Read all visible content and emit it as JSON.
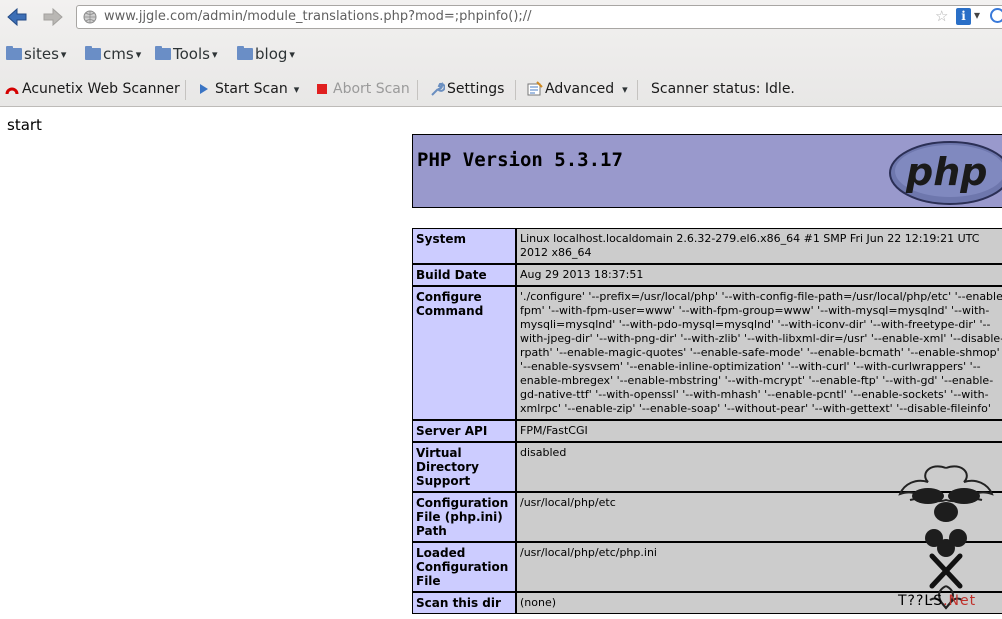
{
  "browser": {
    "url": "www.jjgle.com/admin/module_translations.php?mod=;phpinfo();//",
    "icons": [
      "back-arrow-icon",
      "forward-arrow-icon",
      "globe-icon",
      "star-icon",
      "addon-icon",
      "search-icon"
    ]
  },
  "bookmarks": [
    {
      "label": "sites"
    },
    {
      "label": "cms"
    },
    {
      "label": "Tools"
    },
    {
      "label": "blog"
    }
  ],
  "acunetix": {
    "brand": "Acunetix Web Scanner",
    "start_scan": "Start Scan",
    "abort_scan": "Abort Scan",
    "settings": "Settings",
    "advanced": "Advanced",
    "status": "Scanner status: Idle."
  },
  "page": {
    "start_text": "start",
    "php_version": "PHP Version 5.3.17",
    "logo_text": "php"
  },
  "info_rows": [
    {
      "key": "System",
      "value": "Linux localhost.localdomain 2.6.32-279.el6.x86_64 #1 SMP Fri Jun 22 12:19:21 UTC 2012 x86_64"
    },
    {
      "key": "Build Date",
      "value": "Aug 29 2013 18:37:51"
    },
    {
      "key": "Configure Command",
      "value": "'./configure' '--prefix=/usr/local/php' '--with-config-file-path=/usr/local/php/etc' '--enable-fpm' '--with-fpm-user=www' '--with-fpm-group=www' '--with-mysql=mysqlnd' '--with-mysqli=mysqlnd' '--with-pdo-mysql=mysqlnd' '--with-iconv-dir' '--with-freetype-dir' '--with-jpeg-dir' '--with-png-dir' '--with-zlib' '--with-libxml-dir=/usr' '--enable-xml' '--disable-rpath' '--enable-magic-quotes' '--enable-safe-mode' '--enable-bcmath' '--enable-shmop' '--enable-sysvsem' '--enable-inline-optimization' '--with-curl' '--with-curlwrappers' '--enable-mbregex' '--enable-mbstring' '--with-mcrypt' '--enable-ftp' '--with-gd' '--enable-gd-native-ttf' '--with-openssl' '--with-mhash' '--enable-pcntl' '--enable-sockets' '--with-xmlrpc' '--enable-zip' '--enable-soap' '--without-pear' '--with-gettext' '--disable-fileinfo'"
    },
    {
      "key": "Server API",
      "value": "FPM/FastCGI"
    },
    {
      "key": "Virtual Directory Support",
      "value": "disabled"
    },
    {
      "key": "Configuration File (php.ini) Path",
      "value": "/usr/local/php/etc"
    },
    {
      "key": "Loaded Configuration File",
      "value": "/usr/local/php/etc/php.ini"
    },
    {
      "key": "Scan this dir",
      "value": "(none)"
    }
  ],
  "watermark": {
    "text_main": "T??LS",
    "text_net": ".Net"
  },
  "colors": {
    "php_header": "#9999cc",
    "key_cell": "#ccccff",
    "value_cell": "#cccccc",
    "abort_red": "#e02020"
  }
}
